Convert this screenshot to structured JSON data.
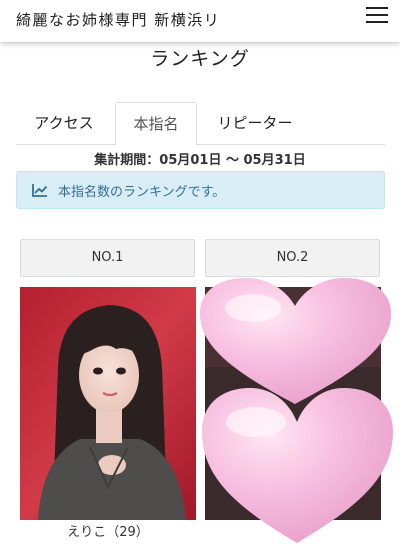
{
  "header": {
    "title": "綺麗なお姉様専門 新横浜リ"
  },
  "page": {
    "title": "ランキング"
  },
  "tabs": [
    {
      "label": "アクセス"
    },
    {
      "label": "本指名"
    },
    {
      "label": "リピーター"
    }
  ],
  "period": "集計期間：05月01日 〜 05月31日",
  "info": {
    "text": "本指名数のランキングです。",
    "icon": "chart-line-icon"
  },
  "rankings": [
    {
      "rank": "NO.1",
      "name": "えりこ（29）"
    },
    {
      "rank": "NO.2"
    }
  ],
  "colors": {
    "info_bg": "#d9edf7",
    "info_text": "#31708f",
    "heart": "#f7b8dc",
    "photo_bg": "#c8283a"
  }
}
